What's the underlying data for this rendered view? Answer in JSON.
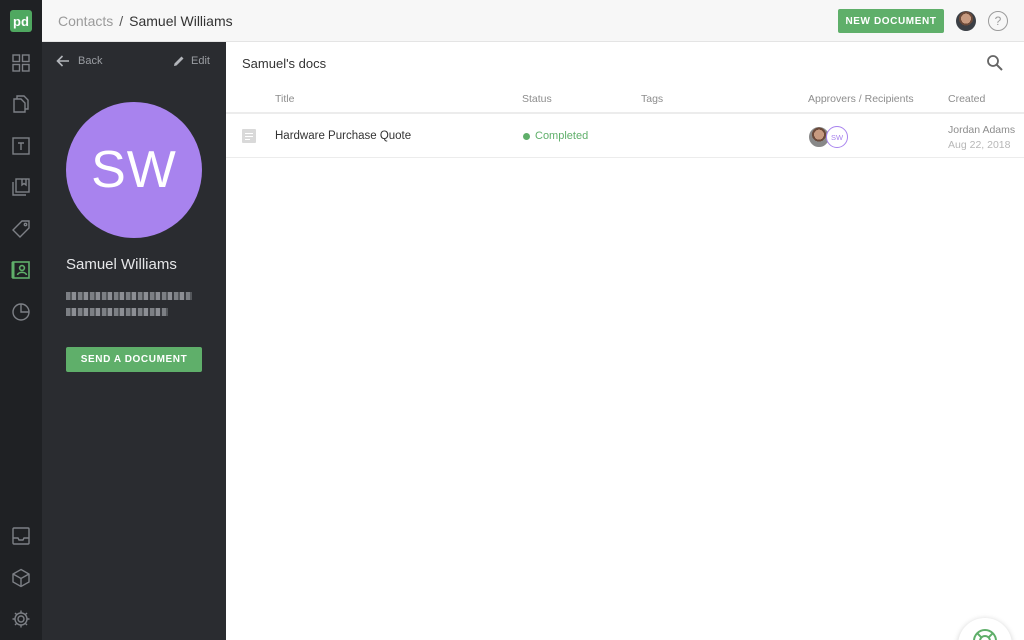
{
  "app": {
    "logo_text": "pd"
  },
  "rail": {
    "items": [
      {
        "name": "dashboard-icon"
      },
      {
        "name": "documents-icon"
      },
      {
        "name": "templates-icon"
      },
      {
        "name": "content-library-icon"
      },
      {
        "name": "catalog-icon"
      },
      {
        "name": "contacts-icon",
        "active": true
      },
      {
        "name": "reports-icon"
      },
      {
        "name": "inbox-icon"
      },
      {
        "name": "integrations-icon"
      },
      {
        "name": "settings-icon"
      }
    ]
  },
  "breadcrumb": {
    "parent": "Contacts",
    "separator": "/",
    "current": "Samuel Williams"
  },
  "header": {
    "new_document_label": "NEW DOCUMENT",
    "help_label": "?"
  },
  "contact": {
    "back_label": "Back",
    "edit_label": "Edit",
    "initials": "SW",
    "name": "Samuel Williams",
    "send_label": "SEND A DOCUMENT",
    "avatar_color": "#a883ee"
  },
  "docs": {
    "title": "Samuel's docs",
    "columns": {
      "title": "Title",
      "status": "Status",
      "tags": "Tags",
      "approvers": "Approvers / Recipients",
      "created": "Created"
    },
    "rows": [
      {
        "title": "Hardware Purchase Quote",
        "status": "Completed",
        "tags": "",
        "recipient_initials": "SW",
        "created_by": "Jordan Adams",
        "created_date": "Aug 22, 2018"
      }
    ]
  },
  "colors": {
    "accent": "#5faf6a",
    "sidebar": "#2a2c30",
    "rail": "#1f2124"
  }
}
